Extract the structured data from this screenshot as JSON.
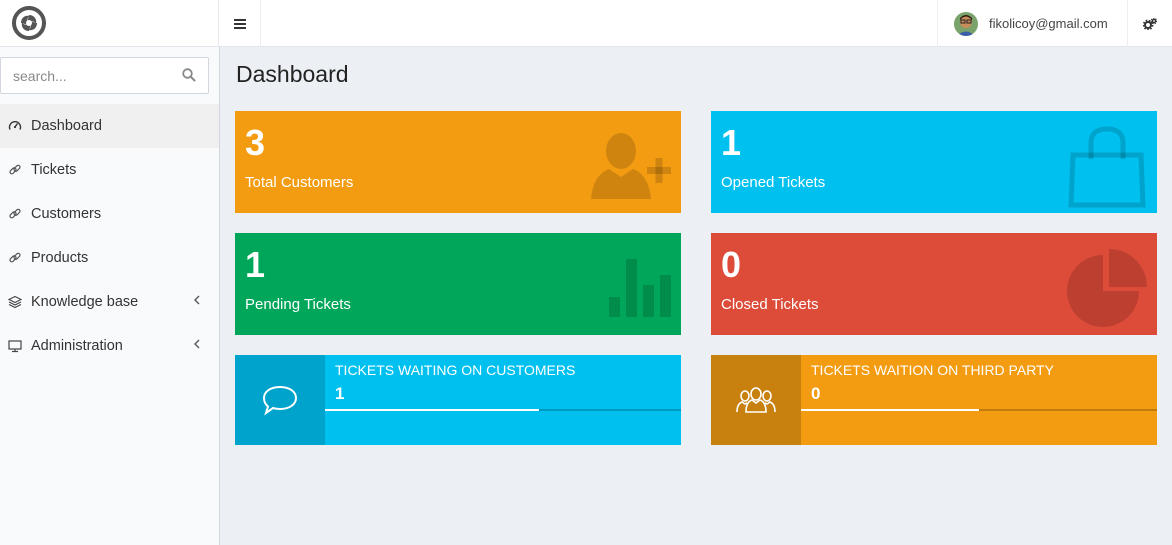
{
  "header": {
    "user_email": "fikolicoy@gmail.com"
  },
  "sidebar": {
    "search": {
      "placeholder": "search..."
    },
    "items": [
      {
        "label": "Dashboard",
        "icon": "dashboard-icon",
        "active": true
      },
      {
        "label": "Tickets",
        "icon": "link-icon"
      },
      {
        "label": "Customers",
        "icon": "link-icon"
      },
      {
        "label": "Products",
        "icon": "link-icon"
      },
      {
        "label": "Knowledge base",
        "icon": "layers-icon",
        "has_submenu": true
      },
      {
        "label": "Administration",
        "icon": "monitor-icon",
        "has_submenu": true
      }
    ]
  },
  "main": {
    "title": "Dashboard",
    "stat_cards": [
      {
        "value": "3",
        "label": "Total Customers",
        "color": "#f39c12",
        "icon": "user-plus-icon"
      },
      {
        "value": "1",
        "label": "Opened Tickets",
        "color": "#00c0ef",
        "icon": "shopping-bag-icon"
      },
      {
        "value": "1",
        "label": "Pending Tickets",
        "color": "#00a65a",
        "icon": "bar-chart-icon"
      },
      {
        "value": "0",
        "label": "Closed Tickets",
        "color": "#dd4b39",
        "icon": "pie-chart-icon"
      }
    ],
    "info_boxes": [
      {
        "title": "TICKETS WAITING ON CUSTOMERS",
        "value": "1",
        "progress": 0.6,
        "color": "#00c0ef",
        "icon": "speech-bubble-icon"
      },
      {
        "title": "TICKETS WAITION ON THIRD PARTY",
        "value": "0",
        "progress": 0.5,
        "color": "#f39c12",
        "icon": "users-icon"
      }
    ]
  }
}
